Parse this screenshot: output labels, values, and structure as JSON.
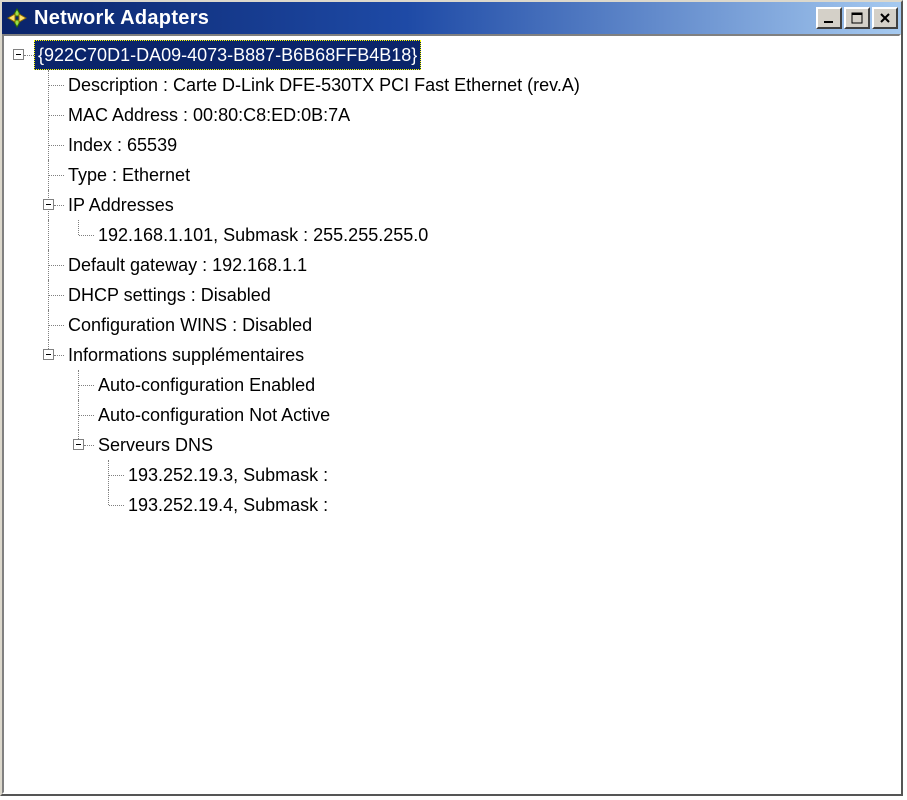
{
  "window": {
    "title": "Network Adapters"
  },
  "tree": {
    "root": {
      "label": "{922C70D1-DA09-4073-B887-B6B68FFB4B18}",
      "selected": true
    },
    "description": "Description : Carte D-Link DFE-530TX PCI Fast Ethernet (rev.A)",
    "mac": "MAC Address : 00:80:C8:ED:0B:7A",
    "index": "Index : 65539",
    "type": "Type : Ethernet",
    "ip_heading": "IP Addresses",
    "ip_entry0": "192.168.1.101, Submask : 255.255.255.0",
    "gateway": "Default gateway : 192.168.1.1",
    "dhcp": "DHCP settings : Disabled",
    "wins": "Configuration WINS : Disabled",
    "extra_heading": "Informations supplémentaires",
    "autoconf_enabled": "Auto-configuration Enabled",
    "autoconf_notactive": "Auto-configuration Not Active",
    "dns_heading": "Serveurs DNS",
    "dns0": "193.252.19.3, Submask :",
    "dns1": "193.252.19.4, Submask :"
  }
}
